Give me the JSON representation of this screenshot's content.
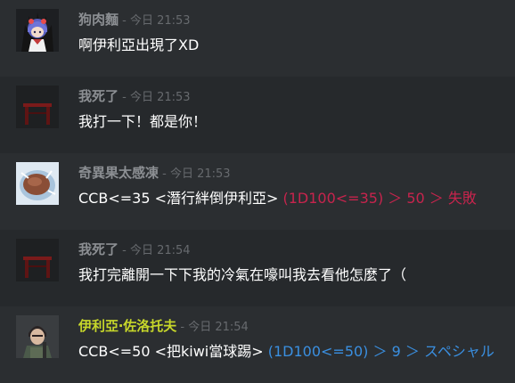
{
  "messages": [
    {
      "author": "狗肉麵",
      "separator": " - ",
      "timestamp": "今日 21:53",
      "text": "啊伊利亞出現了XD",
      "avatar_icon": "anime-girl-avatar-icon"
    },
    {
      "author": "我死了",
      "separator": " - ",
      "timestamp": "今日 21:53",
      "text": "我打一下！都是你！",
      "avatar_icon": "table-avatar-icon"
    },
    {
      "author": "奇異果太感凍",
      "separator": " - ",
      "timestamp": "今日 21:53",
      "text": "CCB<=35 <潛行絆倒伊利亞>",
      "roll_result": " (1D100<=35) ＞ 50 ＞ 失敗",
      "avatar_icon": "frozen-kiwi-avatar-icon"
    },
    {
      "author": "我死了",
      "separator": " - ",
      "timestamp": "今日 21:54",
      "text": "我打完離開一下下我的冷氣在嚎叫我去看他怎麼了（",
      "avatar_icon": "table-avatar-icon"
    },
    {
      "author": "伊利亞‧佐洛托夫",
      "separator": " - ",
      "timestamp": "今日 21:54",
      "text": "CCB<=50 <把kiwi當球踢>",
      "roll_result": " (1D100<=50) ＞ 9 ＞ スペシャル",
      "avatar_icon": "soldier-avatar-icon"
    }
  ],
  "colors": {
    "background": "#2b2e31",
    "alt_background": "#26292c",
    "author_default": "#8c8f93",
    "author_highlight": "#c7d72a",
    "timestamp": "#676a6e",
    "message_text": "#ffffff",
    "roll_fail": "#c7244d",
    "roll_special": "#3a8fe0"
  }
}
